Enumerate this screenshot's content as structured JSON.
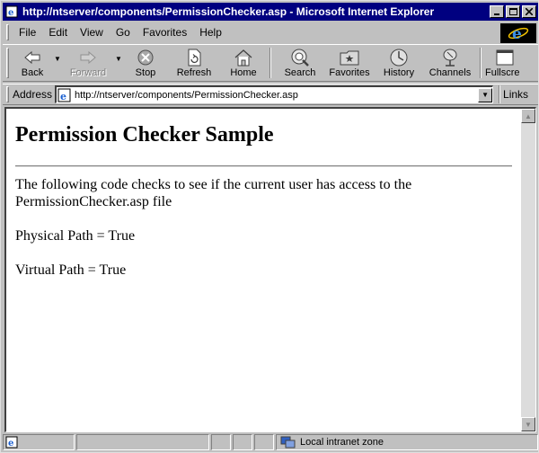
{
  "window": {
    "title": "http://ntserver/components/PermissionChecker.asp - Microsoft Internet Explorer"
  },
  "menu": {
    "items": [
      "File",
      "Edit",
      "View",
      "Go",
      "Favorites",
      "Help"
    ]
  },
  "toolbar": {
    "back": "Back",
    "forward": "Forward",
    "stop": "Stop",
    "refresh": "Refresh",
    "home": "Home",
    "search": "Search",
    "favorites": "Favorites",
    "history": "History",
    "channels": "Channels",
    "fullscreen": "Fullscre"
  },
  "address": {
    "label": "Address",
    "url": "http://ntserver/components/PermissionChecker.asp",
    "links": "Links"
  },
  "page": {
    "heading": "Permission Checker Sample",
    "intro_line1": "The following code checks to see if the current user has access to the",
    "intro_line2": "PermissionChecker.asp file",
    "physical": "Physical Path = True",
    "virtual": "Virtual Path = True"
  },
  "status": {
    "zone": "Local intranet zone"
  },
  "colors": {
    "titlebar": "#000080",
    "chrome": "#c0c0c0",
    "content_bg": "#ffffff"
  }
}
